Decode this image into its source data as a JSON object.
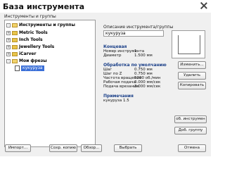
{
  "window": {
    "title": "База инструмента",
    "close_icon": "close-icon"
  },
  "left_panel": {
    "label": "Инструменты и группы"
  },
  "tree": {
    "items": [
      {
        "label": "Инструменты и группы",
        "expander": "-"
      },
      {
        "label": "Metric Tools",
        "expander": "+"
      },
      {
        "label": "Inch Tools",
        "expander": "+"
      },
      {
        "label": "Jewellery Tools",
        "expander": "+"
      },
      {
        "label": "iCarver",
        "expander": "+"
      },
      {
        "label": "Мои фрезы",
        "expander": "-"
      }
    ],
    "selected_item": "кукуруза"
  },
  "right_panel": {
    "label": "Описание инструмента/группы",
    "tool_name": "кукуруза",
    "sections": {
      "tool": {
        "title": "Концевая",
        "rows": [
          {
            "k": "Номер инструмента",
            "v": "1"
          },
          {
            "k": "Диаметр",
            "v": "1.500 мм"
          }
        ]
      },
      "default_processing": {
        "title": "Обработка по умолчанию",
        "rows": [
          {
            "k": "Шаг",
            "v": "0.750 мм"
          },
          {
            "k": "Шаг по Z",
            "v": "0.750 мм"
          },
          {
            "k": "Частота вращения",
            "v": "5000 об./мин"
          },
          {
            "k": "Рабочая подача",
            "v": "3.000 мм/сек"
          },
          {
            "k": "Подача врезания",
            "v": "3.000 мм/сек"
          }
        ]
      },
      "notes": {
        "title": "Примечания",
        "text": "кукуруза 1.5"
      }
    }
  },
  "buttons": {
    "edit": "Изменить...",
    "delete": "Удалить",
    "copy": "Копировать",
    "new_tool": "об. инструмен",
    "new_group": "Доб. группу",
    "import": "Импорт...",
    "save_copy": "Сохр. копию",
    "browse": "Обзор...",
    "select": "Выбрать",
    "cancel": "Отмена"
  }
}
